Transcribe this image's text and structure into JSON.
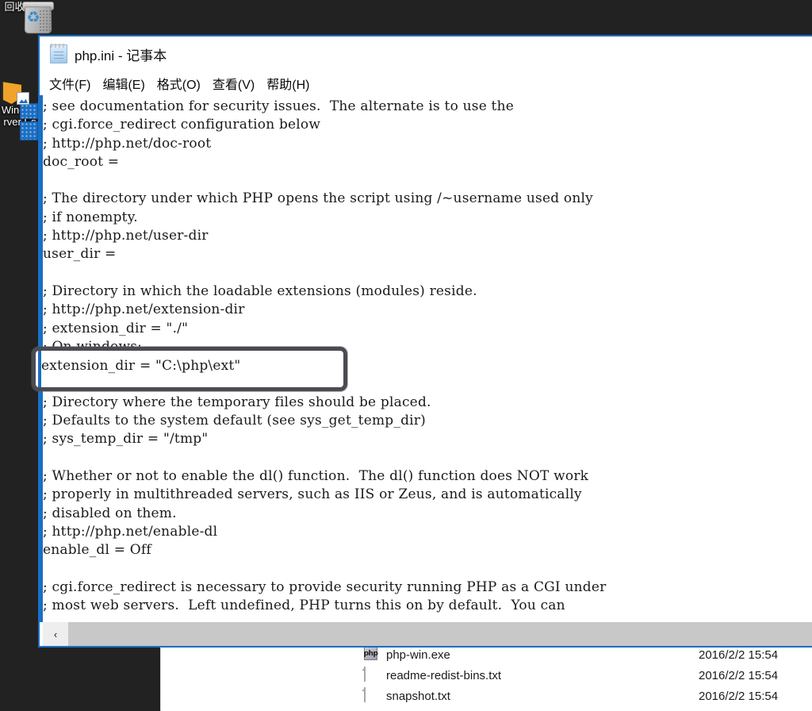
{
  "desktop": {
    "background_color": "#222222",
    "icons": [
      {
        "name": "recycle-bin",
        "label": "回收站"
      },
      {
        "name": "windows-server-essentials",
        "label": "Window\nrver Es"
      }
    ]
  },
  "notepad": {
    "title": "php.ini - 记事本",
    "icon": "notepad-icon",
    "menu": [
      {
        "name": "file",
        "label": "文件(F)"
      },
      {
        "name": "edit",
        "label": "编辑(E)"
      },
      {
        "name": "format",
        "label": "格式(O)"
      },
      {
        "name": "view",
        "label": "查看(V)"
      },
      {
        "name": "help",
        "label": "帮助(H)"
      }
    ],
    "content": "; see documentation for security issues.  The alternate is to use the\n; cgi.force_redirect configuration below\n; http://php.net/doc-root\ndoc_root =\n\n; The directory under which PHP opens the script using /~username used only\n; if nonempty.\n; http://php.net/user-dir\nuser_dir =\n\n; Directory in which the loadable extensions (modules) reside.\n; http://php.net/extension-dir\n; extension_dir = \"./\"\n; On windows:\nextension_dir = \"C:\\php\\ext\"\n\n; Directory where the temporary files should be placed.\n; Defaults to the system default (see sys_get_temp_dir)\n; sys_temp_dir = \"/tmp\"\n\n; Whether or not to enable the dl() function.  The dl() function does NOT work\n; properly in multithreaded servers, such as IIS or Zeus, and is automatically\n; disabled on them.\n; http://php.net/enable-dl\nenable_dl = Off\n\n; cgi.force_redirect is necessary to provide security running PHP as a CGI under\n; most web servers.  Left undefined, PHP turns this on by default.  You can",
    "scrollbar": {
      "left_arrow": "‹"
    },
    "annotation": {
      "highlighted_line": "extension_dir = \"C:\\php\\ext\"",
      "box_color": "#4b4b52"
    }
  },
  "explorer": {
    "files": [
      {
        "icon": "php-file-icon",
        "name": "php-win.exe",
        "date": "2016/2/2 15:54"
      },
      {
        "icon": "text-file-icon",
        "name": "readme-redist-bins.txt",
        "date": "2016/2/2 15:54"
      },
      {
        "icon": "text-file-icon",
        "name": "snapshot.txt",
        "date": "2016/2/2 15:54"
      }
    ]
  }
}
